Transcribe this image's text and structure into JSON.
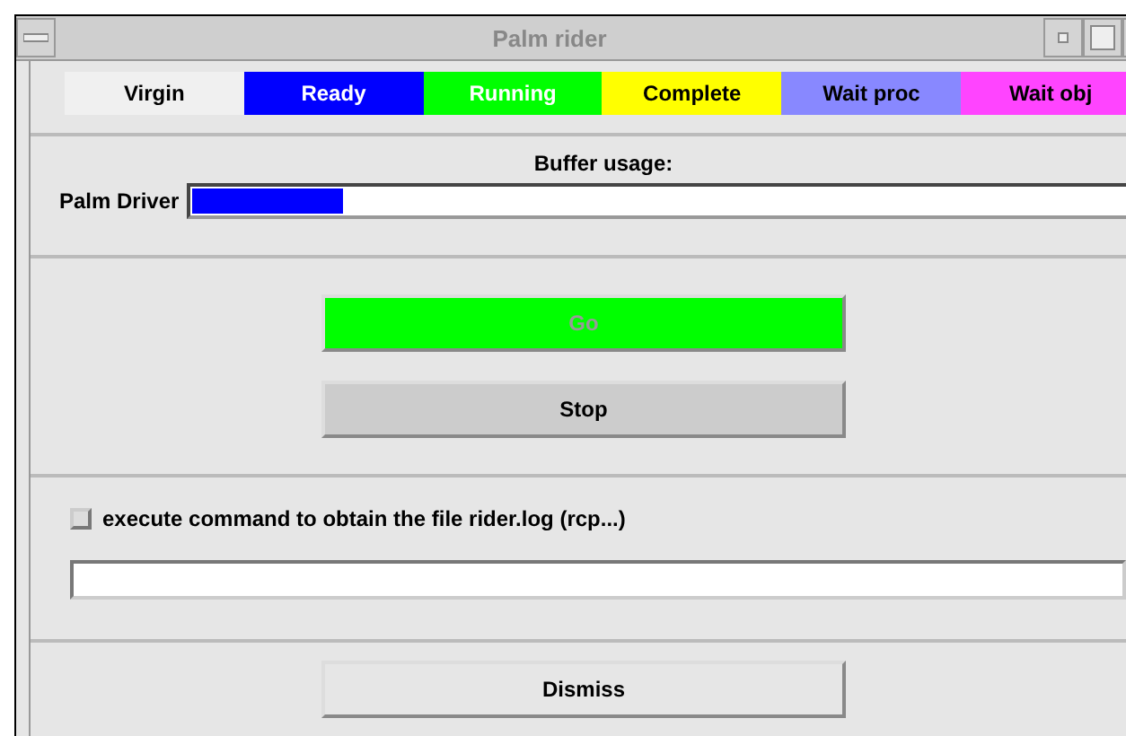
{
  "window": {
    "title": "Palm rider"
  },
  "legend": [
    {
      "label": "Virgin",
      "color": "#f0f0f0"
    },
    {
      "label": "Ready",
      "color": "#0000ff"
    },
    {
      "label": "Running",
      "color": "#00ff00"
    },
    {
      "label": "Complete",
      "color": "#ffff00"
    },
    {
      "label": "Wait proc",
      "color": "#8888ff"
    },
    {
      "label": "Wait obj",
      "color": "#ff44ff"
    }
  ],
  "buffer": {
    "title": "Buffer usage:",
    "label": "Palm Driver",
    "level": 0.16
  },
  "buttons": [
    {
      "label": "Go",
      "disabled": true,
      "color": "#00ff00"
    },
    {
      "label": "Stop",
      "disabled": false,
      "color": "#cccccc"
    }
  ],
  "option": {
    "label": "execute command to obtain the file rider.log (rcp...)",
    "checked": false
  },
  "dismiss": {
    "label": "Dismiss"
  }
}
